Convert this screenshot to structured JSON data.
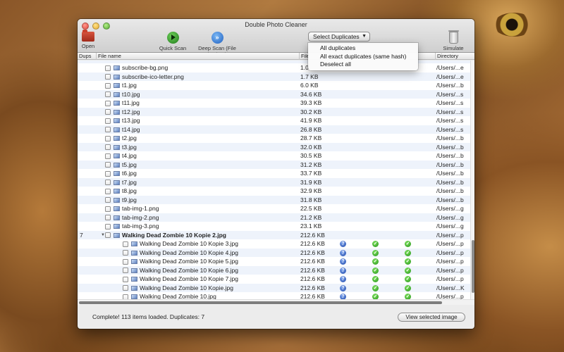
{
  "window": {
    "title": "Double Photo Cleaner"
  },
  "toolbar": {
    "open_label": "Open",
    "quick_scan_label": "Quick Scan",
    "deep_scan_label": "Deep Scan (File hashes)",
    "select_duplicates_label": "Select Duplicates",
    "simulate_delete_label": "Simulate Delete"
  },
  "columns": {
    "dups": "Dups",
    "file_name": "File name",
    "file": "File",
    "directory": "Directory"
  },
  "dropdown": {
    "items": [
      "All duplicates",
      "All exact duplicates (same hash)",
      "Deselect all"
    ]
  },
  "rows": [
    {
      "name": "",
      "size": "",
      "dir": "",
      "partial": true
    },
    {
      "name": "subscribe-bg.png",
      "size": "1.0",
      "dir": "/Users/...e"
    },
    {
      "name": "subscribe-ico-letter.png",
      "size": "1.7 KB",
      "dir": "/Users/...e"
    },
    {
      "name": "t1.jpg",
      "size": "6.0 KB",
      "dir": "/Users/...b"
    },
    {
      "name": "t10.jpg",
      "size": "34.6 KB",
      "dir": "/Users/...s"
    },
    {
      "name": "t11.jpg",
      "size": "39.3 KB",
      "dir": "/Users/...s"
    },
    {
      "name": "t12.jpg",
      "size": "30.2 KB",
      "dir": "/Users/...s"
    },
    {
      "name": "t13.jpg",
      "size": "41.9 KB",
      "dir": "/Users/...s"
    },
    {
      "name": "t14.jpg",
      "size": "26.8 KB",
      "dir": "/Users/...s"
    },
    {
      "name": "t2.jpg",
      "size": "28.7 KB",
      "dir": "/Users/...b"
    },
    {
      "name": "t3.jpg",
      "size": "32.0 KB",
      "dir": "/Users/...b"
    },
    {
      "name": "t4.jpg",
      "size": "30.5 KB",
      "dir": "/Users/...b"
    },
    {
      "name": "t5.jpg",
      "size": "31.2 KB",
      "dir": "/Users/...b"
    },
    {
      "name": "t6.jpg",
      "size": "33.7 KB",
      "dir": "/Users/...b"
    },
    {
      "name": "t7.jpg",
      "size": "31.9 KB",
      "dir": "/Users/...b"
    },
    {
      "name": "t8.jpg",
      "size": "32.9 KB",
      "dir": "/Users/...b"
    },
    {
      "name": "t9.jpg",
      "size": "31.8 KB",
      "dir": "/Users/...b"
    },
    {
      "name": "tab-img-1.png",
      "size": "22.5 KB",
      "dir": "/Users/...g"
    },
    {
      "name": "tab-img-2.png",
      "size": "21.2 KB",
      "dir": "/Users/...g"
    },
    {
      "name": "tab-img-3.png",
      "size": "23.1 KB",
      "dir": "/Users/...g"
    },
    {
      "name": "Walking Dead Zombie 10 Kopie 2.jpg",
      "size": "212.6 KB",
      "dir": "/Users/...p",
      "group": true,
      "dups": "7"
    },
    {
      "name": "Walking Dead Zombie 10 Kopie 3.jpg",
      "size": "212.6 KB",
      "dir": "/Users/...p",
      "child": true
    },
    {
      "name": "Walking Dead Zombie 10 Kopie 4.jpg",
      "size": "212.6 KB",
      "dir": "/Users/...p",
      "child": true
    },
    {
      "name": "Walking Dead Zombie 10 Kopie 5.jpg",
      "size": "212.6 KB",
      "dir": "/Users/...p",
      "child": true
    },
    {
      "name": "Walking Dead Zombie 10 Kopie 6.jpg",
      "size": "212.6 KB",
      "dir": "/Users/...p",
      "child": true
    },
    {
      "name": "Walking Dead Zombie 10 Kopie 7.jpg",
      "size": "212.6 KB",
      "dir": "/Users/...p",
      "child": true
    },
    {
      "name": "Walking Dead Zombie 10 Kopie.jpg",
      "size": "212.6 KB",
      "dir": "/Users/...K",
      "child": true
    },
    {
      "name": "Walking Dead Zombie 10.jpg",
      "size": "212.6 KB",
      "dir": "/Users/...p",
      "child": true
    }
  ],
  "icons": {
    "open": "folder-icon",
    "quick_scan": "play-icon",
    "deep_scan": "fast-forward-icon",
    "simulate_delete": "trash-icon",
    "hash_unknown": "question-icon",
    "match": "check-icon"
  },
  "status": {
    "text": "Complete! 113 items loaded. Duplicates: 7",
    "view_button_label": "View selected image"
  }
}
